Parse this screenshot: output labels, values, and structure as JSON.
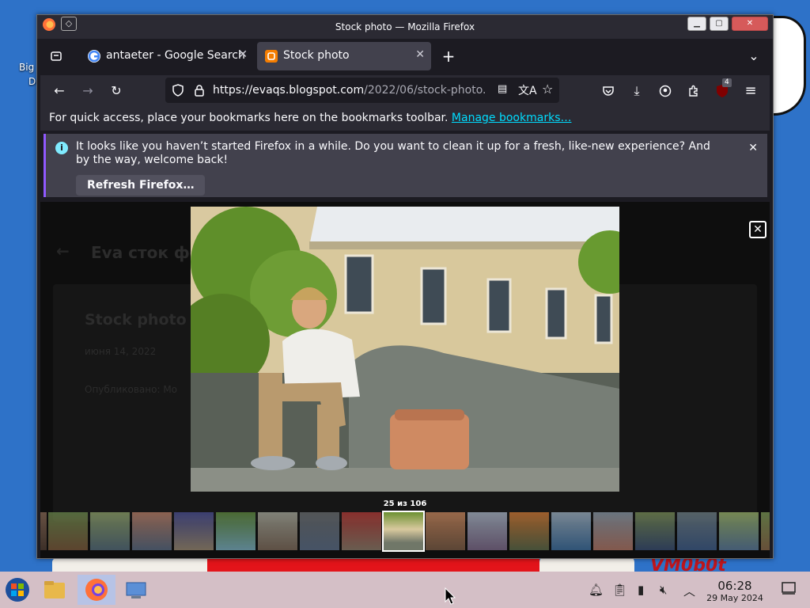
{
  "window": {
    "title": "Stock photo — Mozilla Firefox"
  },
  "tabs": [
    {
      "label": "antaeter - Google Search",
      "active": false,
      "favicon": "google-icon"
    },
    {
      "label": "Stock photo",
      "active": true,
      "favicon": "blogger-icon"
    }
  ],
  "navbar": {
    "url_main": "https://evaqs.blogspot.com",
    "url_rest": "/2022/06/stock-photo.",
    "extension_badge": "4"
  },
  "bookmarks_bar": {
    "text": "For quick access, place your bookmarks here on the bookmarks toolbar.",
    "link": "Manage bookmarks…"
  },
  "notification": {
    "message": "It looks like you haven’t started Firefox in a while. Do you want to clean it up for a fresh, like-new experience? And by the way, welcome back!",
    "button": "Refresh Firefox…"
  },
  "page_behind": {
    "header": "Eva сток фо",
    "post_title": "Stock photo",
    "date": "июня 14, 2022",
    "body": "Опубликовано: Мо"
  },
  "lightbox": {
    "counter": "25 из 106",
    "thumb_count": 18,
    "selected_thumb_index": 8
  },
  "desktop": {
    "icon_label_1": "Big",
    "icon_label_2": "De"
  },
  "taskbar": {
    "time": "06:28",
    "date": "29 May 2024"
  },
  "colors": {
    "accent": "#9059ff",
    "link": "#00ddff",
    "toolbar": "#2b2a33"
  }
}
